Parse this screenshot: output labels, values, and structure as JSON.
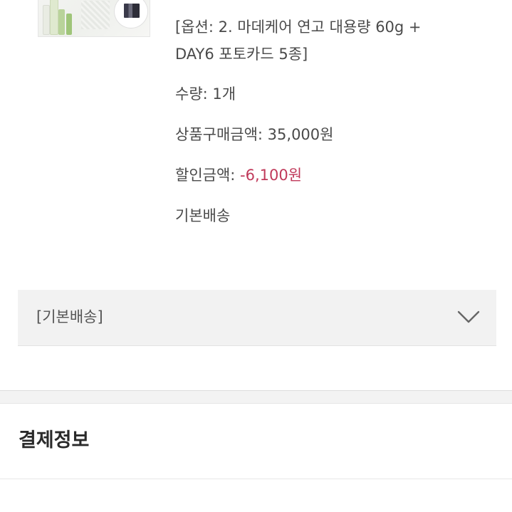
{
  "order_item": {
    "thumbnail_icon": "product-image",
    "option_line1": "[옵션: 2. 마데케어 연고 대용량 60g +",
    "option_line2": "DAY6 포토카드 5종]",
    "quantity_label": "수량: ",
    "quantity_value": "1개",
    "price_label": "상품구매금액: ",
    "price_value": "35,000원",
    "discount_label": "할인금액: ",
    "discount_value": "-6,100원",
    "shipping_type": "기본배송"
  },
  "shipping_select": {
    "label": "[기본배송]",
    "icon": "chevron-down-icon"
  },
  "payment_section": {
    "title": "결제정보"
  },
  "colors": {
    "text": "#4a4a4a",
    "discount": "#c0395a",
    "panel_bg": "#f2f2f2",
    "chevron": "#666666"
  }
}
